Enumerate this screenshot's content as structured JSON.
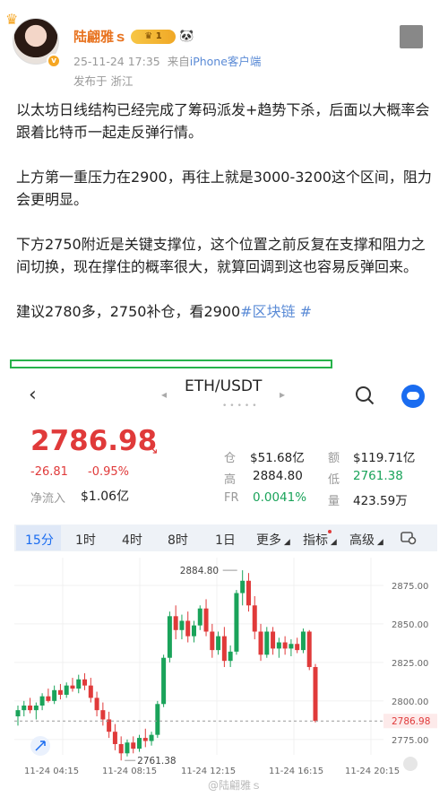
{
  "post": {
    "username": "陆翩雅ｓ",
    "member_level": "1",
    "timestamp": "25-11-24 17:35",
    "source_prefix": "来自",
    "source": "iPhone客户端",
    "location": "发布于 浙江",
    "paragraphs": [
      "以太坊日线结构已经完成了筹码派发+趋势下杀，后面以大概率会跟着比特币一起走反弹行情。",
      "上方第一重压力在2900，再往上就是3000-3200这个区间，阻力会更明显。",
      "下方2750附近是关键支撑位，这个位置之前反复在支撑和阻力之间切换，现在撑住的概率很大，就算回调到这也容易反弹回来。"
    ],
    "suggestion": "建议2780多，2750补仓，看2900",
    "topic": "#区块链 #"
  },
  "ticker": {
    "pair": "ETH/USDT",
    "price": "2786.98",
    "change_abs": "-26.81",
    "change_pct": "-0.95%",
    "inflow_label": "净流入",
    "inflow_value": "$1.06亿",
    "stats": [
      {
        "label": "仓",
        "value": "$51.68亿",
        "color": "normal"
      },
      {
        "label": "额",
        "value": "$119.71亿",
        "color": "normal"
      },
      {
        "label": "高",
        "value": "2884.80",
        "color": "normal"
      },
      {
        "label": "低",
        "value": "2761.38",
        "color": "green"
      },
      {
        "label": "FR",
        "value": "0.0041%",
        "color": "green"
      },
      {
        "label": "量",
        "value": "423.59万",
        "color": "normal"
      }
    ]
  },
  "timeframes": [
    "15分",
    "1时",
    "4时",
    "8时",
    "1日",
    "更多",
    "指标",
    "高级"
  ],
  "active_timeframe": "15分",
  "colors": {
    "up": "#1aa35a",
    "down": "#e03a3a",
    "accent": "#1a6cf0",
    "topic": "#5b8bd6"
  },
  "watermark": "@陆翩雅ｓ",
  "chart_data": {
    "type": "candlestick",
    "y_ticks": [
      "2875.00",
      "2850.00",
      "2825.00",
      "2800.00",
      "2775.00"
    ],
    "ylim": [
      2765,
      2893
    ],
    "x_ticks": [
      "11-24 04:15",
      "11-24 08:15",
      "11-24 12:15",
      "11-24 16:15",
      "11-24 20:15"
    ],
    "last_price_label": "2786.98",
    "high_label": "2884.80",
    "low_label": "2761.38",
    "candles": [
      [
        2790,
        2797,
        2784,
        2794
      ],
      [
        2794,
        2800,
        2790,
        2797
      ],
      [
        2797,
        2802,
        2792,
        2794
      ],
      [
        2794,
        2799,
        2788,
        2797
      ],
      [
        2797,
        2805,
        2794,
        2803
      ],
      [
        2803,
        2808,
        2799,
        2800
      ],
      [
        2800,
        2810,
        2798,
        2807
      ],
      [
        2807,
        2811,
        2801,
        2804
      ],
      [
        2804,
        2812,
        2802,
        2810
      ],
      [
        2810,
        2815,
        2806,
        2808
      ],
      [
        2808,
        2817,
        2805,
        2814
      ],
      [
        2814,
        2818,
        2807,
        2810
      ],
      [
        2810,
        2815,
        2799,
        2802
      ],
      [
        2802,
        2806,
        2790,
        2794
      ],
      [
        2794,
        2799,
        2784,
        2788
      ],
      [
        2788,
        2793,
        2776,
        2780
      ],
      [
        2780,
        2785,
        2768,
        2772
      ],
      [
        2772,
        2777,
        2761.38,
        2766
      ],
      [
        2766,
        2775,
        2764,
        2773
      ],
      [
        2773,
        2777,
        2766,
        2769
      ],
      [
        2769,
        2778,
        2767,
        2776
      ],
      [
        2776,
        2782,
        2770,
        2774
      ],
      [
        2774,
        2780,
        2771,
        2778
      ],
      [
        2778,
        2800,
        2776,
        2798
      ],
      [
        2798,
        2830,
        2796,
        2828
      ],
      [
        2828,
        2858,
        2825,
        2855
      ],
      [
        2855,
        2862,
        2840,
        2846
      ],
      [
        2846,
        2856,
        2840,
        2852
      ],
      [
        2852,
        2858,
        2838,
        2842
      ],
      [
        2842,
        2852,
        2838,
        2849
      ],
      [
        2849,
        2862,
        2846,
        2860
      ],
      [
        2860,
        2866,
        2842,
        2845
      ],
      [
        2845,
        2850,
        2828,
        2833
      ],
      [
        2833,
        2845,
        2830,
        2842
      ],
      [
        2842,
        2848,
        2822,
        2826
      ],
      [
        2826,
        2836,
        2822,
        2832
      ],
      [
        2832,
        2872,
        2830,
        2870
      ],
      [
        2870,
        2884.8,
        2862,
        2878
      ],
      [
        2878,
        2883,
        2858,
        2862
      ],
      [
        2862,
        2868,
        2840,
        2845
      ],
      [
        2845,
        2850,
        2826,
        2830
      ],
      [
        2830,
        2848,
        2828,
        2845
      ],
      [
        2845,
        2848,
        2830,
        2834
      ],
      [
        2834,
        2841,
        2828,
        2838
      ],
      [
        2838,
        2842,
        2830,
        2834
      ],
      [
        2834,
        2840,
        2829,
        2837
      ],
      [
        2837,
        2841,
        2831,
        2833
      ],
      [
        2833,
        2847,
        2831,
        2845
      ],
      [
        2845,
        2846,
        2820,
        2822
      ],
      [
        2822,
        2824,
        2786,
        2786.98
      ]
    ]
  }
}
